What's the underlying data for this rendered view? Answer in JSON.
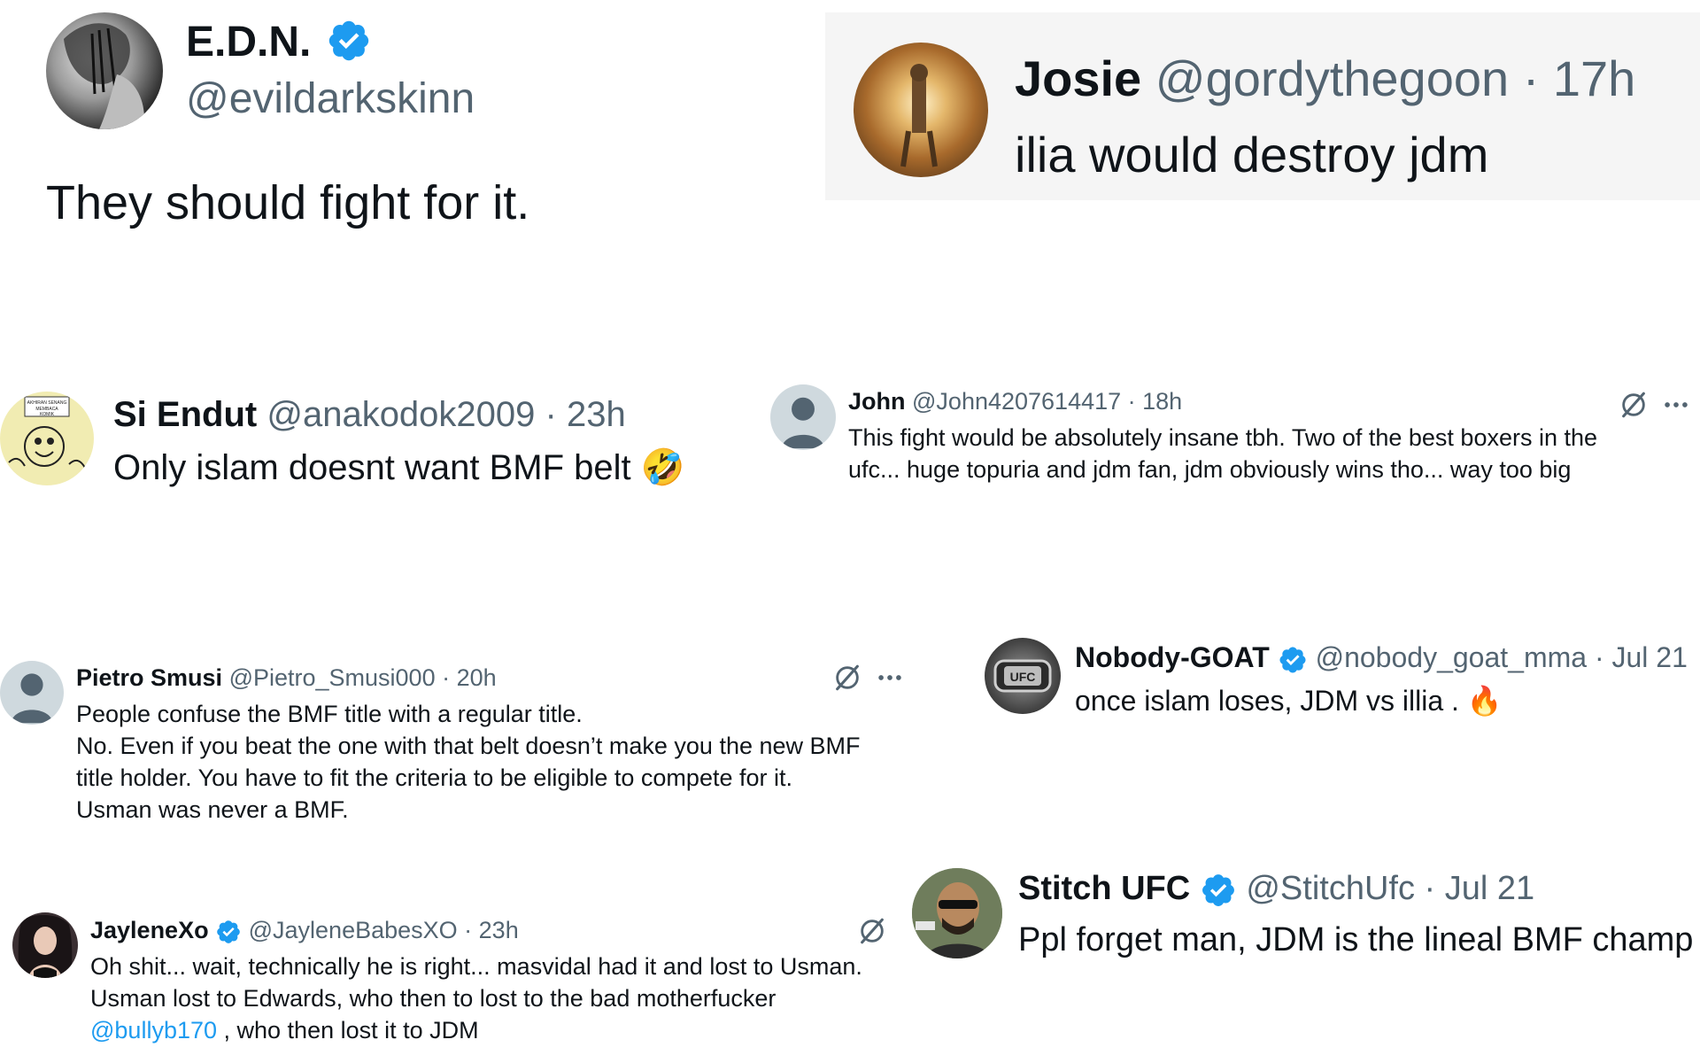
{
  "colors": {
    "verified": "#1d9bf0",
    "text": "#0f1419",
    "muted": "#536471",
    "link": "#1d9bf0",
    "panel": "#f5f5f5"
  },
  "tweets": {
    "edn": {
      "name": "E.D.N.",
      "handle": "@evildarkskinn",
      "text": "They should fight for it.",
      "verified": true
    },
    "josie": {
      "name": "Josie",
      "handle": "@gordythegoon",
      "time": "· 17h",
      "text": "ilia would destroy jdm"
    },
    "si_endut": {
      "name": "Si Endut",
      "handle": "@anakodok2009",
      "time": "· 23h",
      "text": "Only islam doesnt want BMF belt",
      "emoji": "🤣",
      "avatar_text": "AKHIRAN SENANG MEMBACA KOMIK"
    },
    "john": {
      "name": "John",
      "handle": "@John4207614417",
      "time": "· 18h",
      "lines": [
        "This fight would be absolutely insane tbh. Two of the best boxers in the",
        "ufc... huge topuria and jdm fan, jdm obviously wins tho... way too big"
      ],
      "more_icon": "more-dots-icon",
      "grok_icon": "grok-icon"
    },
    "pietro": {
      "name": "Pietro Smusi",
      "handle": "@Pietro_Smusi000",
      "time": "· 20h",
      "lines": [
        "People confuse the BMF title with a regular title.",
        "No. Even if you beat the one with that belt doesn’t make you the new BMF",
        "title holder. You have to fit the criteria to be eligible to compete for it.",
        "Usman was never a BMF."
      ]
    },
    "nobody": {
      "name": "Nobody-GOAT",
      "handle": "@nobody_goat_mma",
      "time": "· Jul 21",
      "text": "once islam loses, JDM vs illia .",
      "emoji": "🔥",
      "verified": true,
      "avatar_text": "UFC"
    },
    "jaylene": {
      "name": "JayleneXo",
      "handle": "@JayleneBabesXO",
      "time": "· 23h",
      "lines": [
        "Oh shit... wait, technically he is right... masvidal had it and lost to Usman.",
        "Usman lost to Edwards, who then to lost to the bad motherfucker"
      ],
      "mention": "@bullyb170",
      "tail": " , who then lost it to JDM",
      "verified": true
    },
    "stitch": {
      "name": "Stitch UFC",
      "handle": "@StitchUfc",
      "time": "· Jul 21",
      "text": "Ppl forget man, JDM is the lineal BMF champ",
      "verified": true
    }
  }
}
